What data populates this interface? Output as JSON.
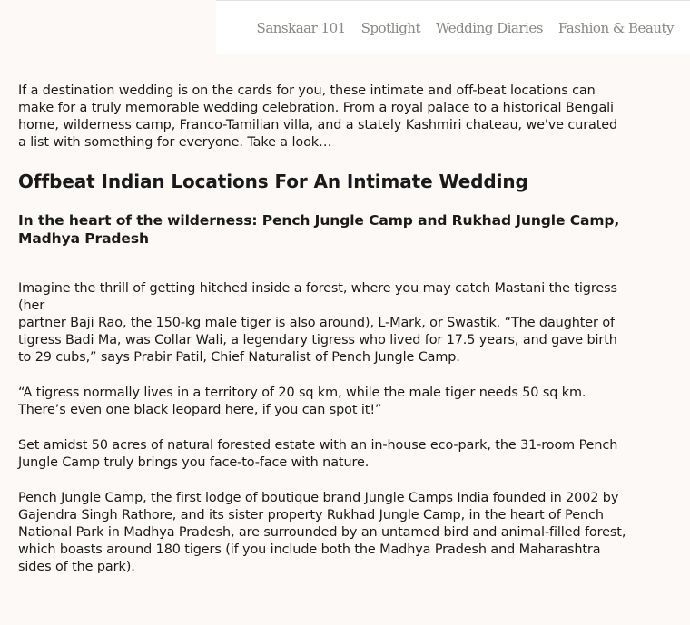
{
  "nav": {
    "items": [
      {
        "label": "Sanskaar 101"
      },
      {
        "label": "Spotlight"
      },
      {
        "label": "Wedding Diaries"
      },
      {
        "label": "Fashion & Beauty"
      }
    ]
  },
  "article": {
    "intro": "If a destination wedding is on the cards for you, these intimate and off-beat locations can make for a truly memorable wedding celebration. From a royal palace to a historical Bengali home, wilderness camp, Franco-Tamilian villa, and a stately Kashmiri chateau, we've curated a list with something for everyone. Take a look…",
    "title": "Offbeat Indian Locations For An Intimate Wedding",
    "section_heading": "In the heart of the wilderness: Pench Jungle Camp and Rukhad Jungle Camp, Madhya Pradesh",
    "para1_a": "Imagine the thrill of getting hitched inside a forest, where you may catch Mastani the tigress (her",
    "para1_b": "partner Baji Rao, the 150-kg male tiger is also around), L-Mark, or Swastik.  “The daughter of tigress Badi Ma, was Collar Wali, a legendary tigress who lived for 17.5 years, and gave birth to 29 cubs,” says Prabir Patil, Chief Naturalist of Pench Jungle Camp.",
    "para2": "“A tigress normally lives in a territory of 20 sq km, while the male tiger needs 50 sq km. There’s even one black leopard here, if you can spot it!”",
    "para3": "Set amidst 50 acres of natural forested estate with an in-house eco-park, the 31-room Pench Jungle Camp truly brings you face-to-face with nature.",
    "para4": "Pench Jungle Camp, the first lodge of boutique brand Jungle Camps India founded in 2002 by Gajendra Singh Rathore, and its sister property Rukhad Jungle Camp, in the heart of Pench National Park in Madhya Pradesh, are surrounded by an untamed bird and animal-filled forest, which boasts around 180 tigers (if you include both the Madhya Pradesh and Maharashtra sides of the park)."
  }
}
